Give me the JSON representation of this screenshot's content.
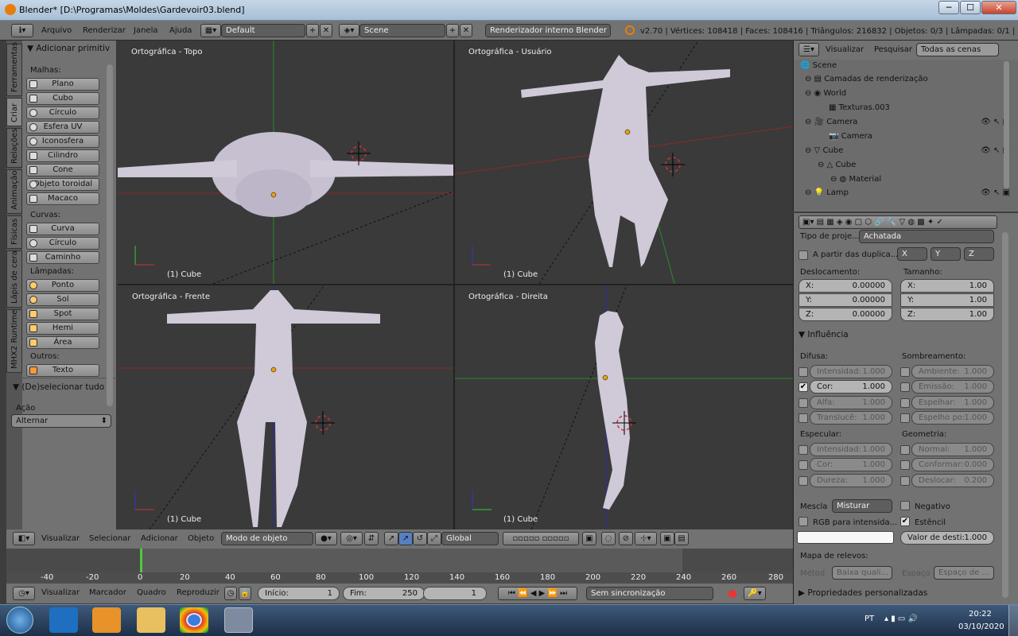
{
  "window": {
    "title": "Blender* [D:\\Programas\\Moldes\\Gardevoir03.blend]",
    "minimize": "─",
    "maximize": "☐",
    "close": "✕"
  },
  "info": {
    "menus": [
      "Arquivo",
      "Renderizar",
      "Janela",
      "Ajuda"
    ],
    "layout": "Default",
    "scene": "Scene",
    "engine": "Renderizador interno Blender",
    "stats": "v2.70 | Vértices: 108418 | Faces: 108416 | Triângulos: 216832 | Objetos: 0/3 | Lâmpadas: 0/1 | Memór"
  },
  "vtabs": [
    "Ferramentas",
    "Criar",
    "Relações",
    "Animação",
    "Físicas",
    "Lápis de cera",
    "MHX2 Runtime"
  ],
  "shelf": {
    "title": "Adicionar primitiv",
    "malhas_label": "Malhas:",
    "malhas": [
      "Plano",
      "Cubo",
      "Círculo",
      "Esfera UV",
      "Iconosfera",
      "Cilindro",
      "Cone",
      "Objeto toroidal",
      "Macaco"
    ],
    "curvas_label": "Curvas:",
    "curvas": [
      "Curva",
      "Círculo",
      "Caminho"
    ],
    "lampadas_label": "Lâmpadas:",
    "lampadas": [
      "Ponto",
      "Sol",
      "Spot",
      "Hemi",
      "Área"
    ],
    "outros_label": "Outros:",
    "outros": [
      "Texto"
    ],
    "op_title": "(De)selecionar tudo",
    "acao_label": "Ação",
    "acao_value": "Alternar"
  },
  "viewports": [
    {
      "label": "Ortográfica - Topo",
      "footer": "(1) Cube"
    },
    {
      "label": "Ortográfica - Usuário",
      "footer": "(1) Cube"
    },
    {
      "label": "Ortográfica - Frente",
      "footer": "(1) Cube"
    },
    {
      "label": "Ortográfica - Direita",
      "footer": "(1) Cube"
    }
  ],
  "view3d_header": {
    "menus": [
      "Visualizar",
      "Selecionar",
      "Adicionar",
      "Objeto"
    ],
    "mode": "Modo de objeto",
    "orientation": "Global"
  },
  "timeline": {
    "ticks": [
      "-40",
      "-20",
      "0",
      "20",
      "40",
      "60",
      "80",
      "100",
      "120",
      "140",
      "160",
      "180",
      "200",
      "220",
      "240",
      "260",
      "280"
    ],
    "menus": [
      "Visualizar",
      "Marcador",
      "Quadro",
      "Reproduzir"
    ],
    "start": "Início:",
    "start_val": "1",
    "end": "Fim:",
    "end_val": "250",
    "current": "1",
    "sync": "Sem sincronização"
  },
  "outliner": {
    "tabs": [
      "Visualizar",
      "Pesquisar",
      "Todas as cenas"
    ],
    "items": [
      "Scene",
      "Camadas de renderização",
      "World",
      "Texturas.003",
      "Camera",
      "Camera",
      "Cube",
      "Cube",
      "Material",
      "Lamp"
    ]
  },
  "props": {
    "proj_label": "Tipo de proje...",
    "proj_value": "Achatada",
    "dupli_label": "A partir das duplica...",
    "axes": [
      "X",
      "Y",
      "Z"
    ],
    "desloc_label": "Deslocamento:",
    "tam_label": "Tamanho:",
    "desloc": [
      "X:",
      "0.00000",
      "Y:",
      "0.00000",
      "Z:",
      "0.00000"
    ],
    "tam": [
      "X:",
      "1.00",
      "Y:",
      "1.00",
      "Z:",
      "1.00"
    ],
    "influencia": "Influência",
    "difusa": "Difusa:",
    "sombreamento": "Sombreamento:",
    "difusa_items": [
      [
        "Intensidad:",
        "1.000"
      ],
      [
        "Cor:",
        "1.000"
      ],
      [
        "Alfa:",
        "1.000"
      ],
      [
        "Translucê:",
        "1.000"
      ]
    ],
    "sombra_items": [
      [
        "Ambiente:",
        "1.000"
      ],
      [
        "Emissão:",
        "1.000"
      ],
      [
        "Espelhar:",
        "1.000"
      ],
      [
        "Espelho po:",
        "1.000"
      ]
    ],
    "especular": "Especular:",
    "geometria": "Geometria:",
    "espec_items": [
      [
        "Intensidad:",
        "1.000"
      ],
      [
        "Cor:",
        "1.000"
      ],
      [
        "Dureza:",
        "1.000"
      ]
    ],
    "geo_items": [
      [
        "Normal:",
        "1.000"
      ],
      [
        "Conformar:",
        "0.000"
      ],
      [
        "Deslocar:",
        "0.200"
      ]
    ],
    "mescla": "Mescla",
    "mescla_val": "Misturar",
    "negativo": "Negativo",
    "rgb": "RGB para intensida...",
    "estencil": "Estêncil",
    "valor": "Valor de desti:",
    "valor_val": "1.000",
    "mapa": "Mapa de relevos:",
    "metod": "Métod",
    "metod_val": "Baixa quali...",
    "espaco": "Espaço",
    "espaco_val": "Espaço de ...",
    "custom": "Propriedades personalizadas"
  },
  "taskbar": {
    "lang": "PT",
    "time": "20:22",
    "date": "03/10/2020"
  }
}
